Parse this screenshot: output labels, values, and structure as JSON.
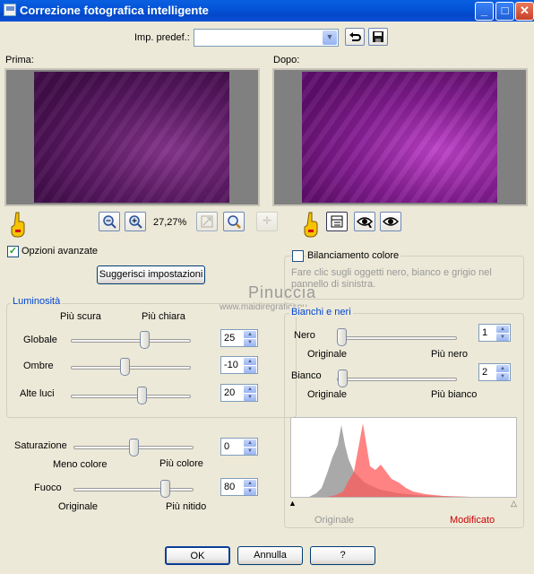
{
  "window": {
    "title": "Correzione fotografica intelligente",
    "controls": {
      "minimize": "_",
      "maximize": "□",
      "close": "✕"
    }
  },
  "preset": {
    "label": "Imp. predef.:",
    "value": ""
  },
  "before": {
    "label": "Prima:"
  },
  "after": {
    "label": "Dopo:"
  },
  "zoom": {
    "value": "27,27%"
  },
  "advanced_options": {
    "label": "Opzioni avanzate",
    "checked": true
  },
  "suggest_button": "Suggerisci impostazioni",
  "color_balance": {
    "label": "Bilanciamento colore",
    "checked": false,
    "help": "Fare clic sugli oggetti nero, bianco e grigio nel pannello di sinistra."
  },
  "watermark": {
    "line1": "Pinuccia",
    "line2": "www.maidiregraficanu"
  },
  "brightness": {
    "legend": "Luminosità",
    "left_hint": "Più scura",
    "right_hint": "Più chiara",
    "rows": [
      {
        "label": "Globale",
        "value": "25"
      },
      {
        "label": "Ombre",
        "value": "-10"
      },
      {
        "label": "Alte luci",
        "value": "20"
      }
    ]
  },
  "saturation": {
    "label": "Saturazione",
    "value": "0",
    "left_hint": "Meno colore",
    "right_hint": "Più colore"
  },
  "focus": {
    "label": "Fuoco",
    "value": "80",
    "left_hint": "Originale",
    "right_hint": "Più nitido"
  },
  "blacks_whites": {
    "legend": "Bianchi e neri",
    "black": {
      "label": "Nero",
      "value": "1",
      "left_hint": "Originale",
      "right_hint": "Più nero"
    },
    "white": {
      "label": "Bianco",
      "value": "2",
      "left_hint": "Originale",
      "right_hint": "Più bianco"
    }
  },
  "histogram": {
    "original_label": "Originale",
    "modified_label": "Modificato",
    "colors": {
      "original": "#999999",
      "modified": "#ff6b6b",
      "modified_text": "#cc0000"
    }
  },
  "buttons": {
    "ok": "OK",
    "cancel": "Annulla",
    "help": "?"
  },
  "icons": {
    "undo": "undo-arrow-icon",
    "save": "floppy-disk-icon",
    "zoom_in": "magnifier-plus-icon",
    "zoom_out": "magnifier-minus-icon",
    "fit": "fit-window-icon",
    "pan": "pan-icon",
    "hand": "pointing-hand-icon",
    "eye_dropper": "eye-icon"
  }
}
